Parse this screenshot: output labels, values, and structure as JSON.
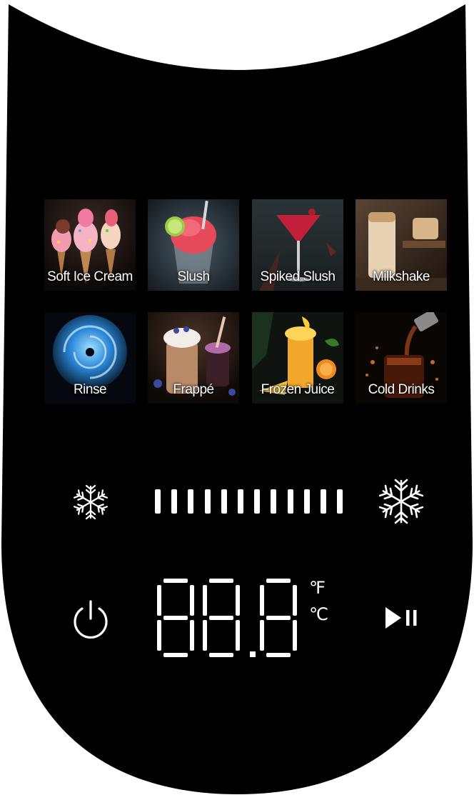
{
  "panel": {
    "background": "#000000",
    "foreground": "#ffffff"
  },
  "modes": [
    {
      "label": "Soft Ice Cream",
      "icon": "soft-ice-cream-image"
    },
    {
      "label": "Slush",
      "icon": "slush-image"
    },
    {
      "label": "Spiked Slush",
      "icon": "spiked-slush-image"
    },
    {
      "label": "Milkshake",
      "icon": "milkshake-image"
    },
    {
      "label": "Rinse",
      "icon": "rinse-image"
    },
    {
      "label": "Frappé",
      "icon": "frappe-image"
    },
    {
      "label": "Frozen Juice",
      "icon": "frozen-juice-image"
    },
    {
      "label": "Cold Drinks",
      "icon": "cold-drinks-image"
    }
  ],
  "controls": {
    "less_cold_icon": "snowflake-small-icon",
    "more_cold_icon": "snowflake-large-icon",
    "power_icon": "power-icon",
    "play_pause_icon": "play-pause-icon",
    "level_segments": 12,
    "level_lit": 12
  },
  "display": {
    "digits": "88.8",
    "unit_f": "℉",
    "unit_c": "℃"
  }
}
